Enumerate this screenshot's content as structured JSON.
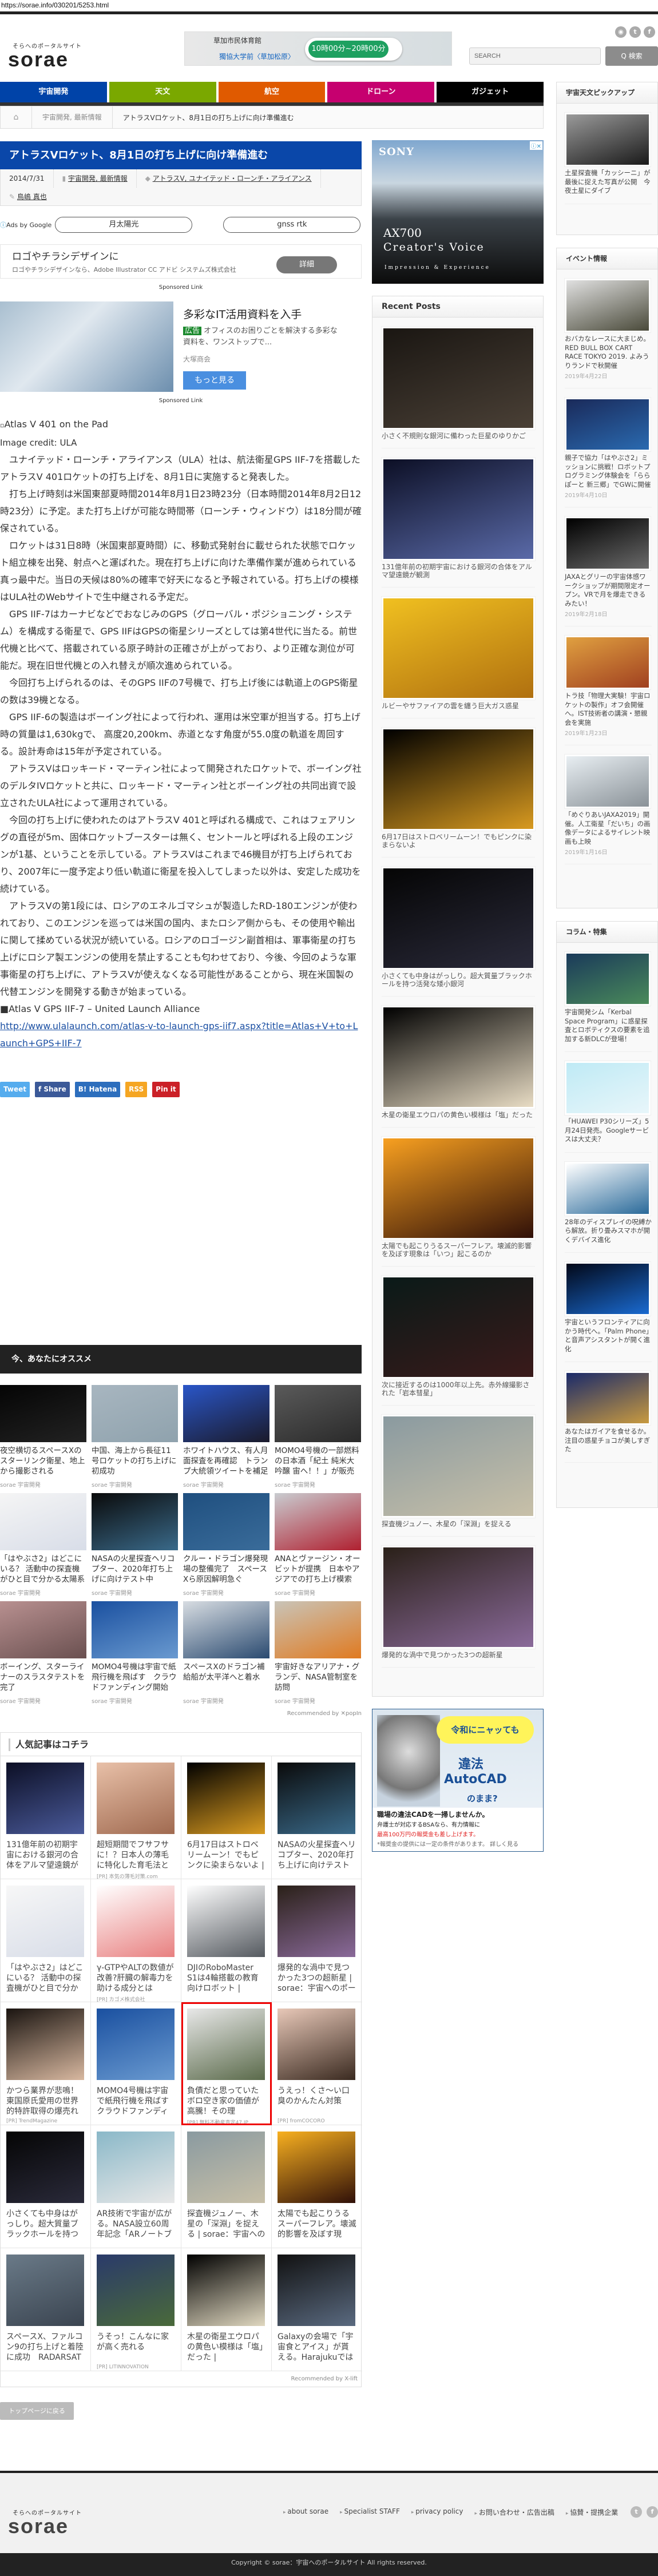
{
  "browser": {
    "url": "https://sorae.info/030201/5253.html"
  },
  "header": {
    "tagline": "そらへのポータルサイト",
    "logo": "sorae",
    "ad": {
      "place": "草加市民体育館",
      "place2": "獨協大学前〈草加松原〉",
      "hours": "10時00分~20時00分"
    },
    "social": [
      "rss-icon",
      "twitter-icon",
      "facebook-icon"
    ],
    "search_placeholder": "SEARCH",
    "search_button": "Q 検索"
  },
  "nav": [
    {
      "label": "宇宙開発",
      "color": "#0043a8"
    },
    {
      "label": "天文",
      "color": "#7aa800"
    },
    {
      "label": "航空",
      "color": "#e05a00"
    },
    {
      "label": "ドローン",
      "color": "#c6006f"
    },
    {
      "label": "ガジェット",
      "color": "#000000"
    }
  ],
  "breadcrumb": {
    "category": "宇宙開発, 最新情報",
    "current": "アトラスVロケット、8月1日の打ち上げに向け準備進む"
  },
  "article": {
    "title": "アトラスVロケット、8月1日の打ち上げに向け準備進む",
    "date": "2014/7/31",
    "categories": "宇宙開発, 最新情報",
    "tags": "アトラスV, ユナイテッド・ローンチ・アライアンス",
    "author": "鳥嶋 真也",
    "ads_by_google": "Ads by Google",
    "keywords": [
      "月太陽光",
      "gnss rtk"
    ],
    "ad1": {
      "headline": "ロゴやチラシデザインに",
      "desc": "ロゴやチラシデザインなら、Adobe Illustrator CC アドビ システムズ株式会社",
      "button": "詳細"
    },
    "sponsored": "Sponsored Link",
    "ad2": {
      "headline": "多彩なIT活用資料を入手",
      "badge": "広告",
      "desc": "オフィスのお困りごとを解決する多彩な資料を、ワンストップで...",
      "source": "大塚商会",
      "button": "もっと見る"
    },
    "image_alt": "Atlas V 401 on the Pad",
    "image_credit": "Image credit: ULA",
    "paragraphs": [
      "ユナイテッド・ローンチ・アライアンス（ULA）社は、航法衛星GPS IIF-7を搭載したアトラスV 401ロケットの打ち上げを、8月1日に実施すると発表した。",
      "打ち上げ時刻は米国東部夏時間2014年8月1日23時23分（日本時間2014年8月2日12時23分）に予定。また打ち上げが可能な時間帯（ローンチ・ウィンドウ）は18分間が確保されている。",
      "ロケットは31日8時（米国東部夏時間）に、移動式発射台に載せられた状態でロケット組立棟を出発、射点へと運ばれた。現在打ち上げに向けた準備作業が進められている真っ最中だ。当日の天候は80%の確率で好天になると予報されている。打ち上げの模様はULA社のWebサイトで生中継される予定だ。",
      "GPS IIF-7はカーナビなどでおなじみのGPS（グローバル・ポジショニング・システム）を構成する衛星で、GPS IIFはGPSの衛星シリーズとしては第4世代に当たる。前世代機と比べて、搭載されている原子時計の正確さが上がっており、より正確な測位が可能だ。現在旧世代機との入れ替えが順次進められている。",
      "今回打ち上げられるのは、そのGPS IIFの7号機で、打ち上げ後には軌道上のGPS衛星の数は39機となる。",
      "GPS IIF-6の製造はボーイング社によって行われ、運用は米空軍が担当する。打ち上げ時の質量は1,630kgで、 高度20,200km、赤道となす角度が55.0度の軌道を周回する。設計寿命は15年が予定されている。",
      "アトラスVはロッキード・マーティン社によって開発されたロケットで、ボーイング社のデルタIVロケットと共に、ロッキード・マーティン社とボーイング社の共同出資で設立されたULA社によって運用されている。",
      "今回の打ち上げに使われたのはアトラスV 401と呼ばれる構成で、これはフェアリングの直径が5m、固体ロケットブースターは無く、セントールと呼ばれる上段のエンジンが1基、ということを示している。アトラスVはこれまで46機目が打ち上げられており、2007年に一度予定より低い軌道に衛星を投入してしまった以外は、安定した成功を続けている。",
      "アトラスVの第1段には、ロシアのエネルゴマシュが製造したRD-180エンジンが使われており、このエンジンを巡っては米国の国内、またロシア側からも、その使用や輸出に関して揉めている状況が続いている。ロシアのロゴージン副首相は、軍事衛星の打ち上げにロシア製エンジンの使用を禁止することも匂わせており、今後、今回のような軍事衛星の打ち上げに、アトラスVが使えなくなる可能性があることから、現在米国製の代替エンジンを開発する動きが始まっている。"
    ],
    "reference": "■Atlas V GPS IIF-7 – United Launch Alliance",
    "reference_link": "http://www.ulalaunch.com/atlas-v-to-launch-gps-iif7.aspx?title=Atlas+V+to+Launch+GPS+IIF-7",
    "share": [
      {
        "label": "Tweet",
        "color": "#55acee",
        "icon": "twitter-icon"
      },
      {
        "label": "f Share",
        "color": "#3b5998",
        "icon": "facebook-icon"
      },
      {
        "label": "B! Hatena",
        "color": "#2c6ebd",
        "icon": "hatena-icon"
      },
      {
        "label": "RSS",
        "color": "#f5a623",
        "icon": "rss-icon"
      },
      {
        "label": "Pin it",
        "color": "#cb2027",
        "icon": "pinterest-icon"
      }
    ]
  },
  "recommend": {
    "title": "今、あなたにオススメ",
    "source": "sorae 宇宙開発",
    "credit": "Recommended by ✕popIn",
    "items": [
      {
        "title": "夜空横切るスペースXのスターリンク衛星、地上から撮影される",
        "c1": "#050505",
        "c2": "#222222"
      },
      {
        "title": "中国、海上から長征11号ロケットの打ち上げに初成功",
        "c1": "#a8b6c0",
        "c2": "#8fa2ad"
      },
      {
        "title": "ホワイトハウス、有人月面探査を再確認　トランプ大統領ツイートを補足",
        "c1": "#2a56c8",
        "c2": "#1a1a2a"
      },
      {
        "title": "MOMO4号機の一部燃料の日本酒「紀土 純米大吟醸 宙へ！！」が販売開始",
        "c1": "#5a5a5a",
        "c2": "#2a2a2a"
      },
      {
        "title": "「はやぶさ2」はどこにいる？ 活動中の探査機がひと目で分かる太陽系マ…",
        "c1": "#f5f5f5",
        "c2": "#d8dde8"
      },
      {
        "title": "NASAの火星探査ヘリコプター、2020年打ち上げに向けテスト中",
        "c1": "#0a0a0a",
        "c2": "#3a6a8a"
      },
      {
        "title": "クルー・ドラゴン爆発現場の整備完了　スペースXら原因解明急ぐ",
        "c1": "#1f4f7f",
        "c2": "#3a6c9a"
      },
      {
        "title": "ANAとヴァージン・オービットが提携　日本やアジアでの打ち上げ模索",
        "c1": "#c9ccd0",
        "c2": "#b02030"
      },
      {
        "title": "ボーイング、スターライナーのスラスタテストを完了",
        "c1": "#b89090",
        "c2": "#6a5050"
      },
      {
        "title": "MOMO4号機は宇宙で紙飛行機を飛ばす　クラウドファンディング開始",
        "c1": "#1a50a0",
        "c2": "#6a9ad0"
      },
      {
        "title": "スペースXのドラゴン補給船が太平洋へと着水",
        "c1": "#d8dde2",
        "c2": "#2a4a70"
      },
      {
        "title": "宇宙好きなアリアナ・グランデ、NASA管制室を訪問",
        "c1": "#c9c4b8",
        "c2": "#e07a20"
      }
    ]
  },
  "popular": {
    "title": "人気記事はコチラ",
    "credit": "Recommended by X-lift",
    "items": [
      {
        "title": "131億年前の初期宇宙における銀河の合体をアルマ望遠鏡が観",
        "pr": "",
        "c1": "#0c0f25",
        "c2": "#4a5a9a"
      },
      {
        "title": "超短期間でフサフサに！？日本人の薄毛に特化した育毛法と",
        "pr": "[PR] 本気の薄毛対策.com",
        "c1": "#e8c0a8",
        "c2": "#a06a50"
      },
      {
        "title": "6月17日はストロベリームーン！でもピンクに染まらないよ |",
        "pr": "",
        "c1": "#000000",
        "c2": "#d89a20"
      },
      {
        "title": "NASAの火星探査ヘリコプター、2020年打ち上げに向けテスト",
        "pr": "",
        "c1": "#0a0a0a",
        "c2": "#3a6a8a"
      },
      {
        "title": "「はやぶさ2」はどこにいる？ 活動中の探査機がひと目で分か",
        "pr": "",
        "c1": "#f7f7f7",
        "c2": "#d8dde8"
      },
      {
        "title": "γ-GTPやALTの数値が改善?肝臓の解毒力を助ける成分とは",
        "pr": "[PR] カゴメ株式会社",
        "c1": "#ffffff",
        "c2": "#e88080"
      },
      {
        "title": "DJIのRoboMaster S1は4輪搭載の教育向けロボット | sorae：宇",
        "pr": "",
        "c1": "#ffffff",
        "c2": "#555a60"
      },
      {
        "title": "爆発的な渦中で見つかった3つの超新星 | sorae：宇宙へのポー",
        "pr": "",
        "c1": "#2a2018",
        "c2": "#8a6a9a"
      },
      {
        "title": "かつら業界が悲鳴！東国原氏愛用の世界的特許取得の爆売れ",
        "pr": "[PR] TrendMagazine",
        "c1": "#1a1410",
        "c2": "#d8b8a0"
      },
      {
        "title": "MOMO4号機は宇宙で紙飛行機を飛ばす　クラウドファンディ",
        "pr": "",
        "c1": "#1a50a0",
        "c2": "#6a9ad0"
      },
      {
        "title": "負債だと思っていたボロ空き家の価値が高騰！その理",
        "pr": "[PR] 無料不動産査定47.JP",
        "c1": "#e8e8e8",
        "c2": "#5a6a4a",
        "highlight": true
      },
      {
        "title": "うえっ！くさ〜い口臭のかんたん対策",
        "pr": "[PR] fromCOCORO",
        "c1": "#e8c8b8",
        "c2": "#3a2a20"
      },
      {
        "title": "小さくても中身はがっしり。超大質量ブラックホールを持つ",
        "pr": "",
        "c1": "#050505",
        "c2": "#2a2a3a"
      },
      {
        "title": "AR技術で宇宙が広がる。NASA設立60周年記念「ARノートブ",
        "pr": "",
        "c1": "#8ab8c8",
        "c2": "#e8e8e8"
      },
      {
        "title": "探査機ジュノー、木星の「深淵」を捉える | sorae：宇宙への",
        "pr": "",
        "c1": "#8a9aa0",
        "c2": "#c8c0a8"
      },
      {
        "title": "太陽でも起こりうるスーパーフレア。壊滅的影響を及ぼす現",
        "pr": "",
        "c1": "#f8b020",
        "c2": "#301008"
      },
      {
        "title": "スペースX、ファルコン9の打ち上げと着陸に成功　RADARSAT",
        "pr": "",
        "c1": "#6a7a88",
        "c2": "#3a4450"
      },
      {
        "title": "うそっ！こんなに家が高く売れる",
        "pr": "[PR] LITINNOVATION",
        "c1": "#2a3a6a",
        "c2": "#4a6a3a"
      },
      {
        "title": "木星の衛星エウロパの黄色い模様は「塩」だった |",
        "pr": "",
        "c1": "#000000",
        "c2": "#e0d8c0"
      },
      {
        "title": "Galaxyの会場で「宇宙食とアイス」が貰える。Harajukuでは",
        "pr": "",
        "c1": "#111111",
        "c2": "#5a6a80"
      }
    ],
    "back_to_top": "トップページに戻る"
  },
  "middle": {
    "sony_ad": {
      "brand": "SONY",
      "model": "AX700",
      "line": "Creator's Voice",
      "sub": "Impression & Experience"
    },
    "recent_title": "Recent Posts",
    "recent": [
      {
        "title": "小さく不規則な銀河に備わった巨星のゆりかご",
        "c1": "#1a1612",
        "c2": "#4a4036"
      },
      {
        "title": "131億年前の初期宇宙における銀河の合体をアルマ望遠鏡が観測",
        "c1": "#0c0f25",
        "c2": "#5a6aa8"
      },
      {
        "title": "ルビーやサファイアの雲を纏う巨大ガス惑星",
        "c1": "#f0c020",
        "c2": "#b07010"
      },
      {
        "title": "6月17日はストロベリームーン！でもピンクに染まらないよ",
        "c1": "#000000",
        "c2": "#d89a20"
      },
      {
        "title": "小さくても中身はがっしり。超大質量ブラックホールを持つ活発な矮小銀河",
        "c1": "#050505",
        "c2": "#2a2a3a"
      },
      {
        "title": "木星の衛星エウロパの黄色い模様は「塩」だった",
        "c1": "#000000",
        "c2": "#e8dcc4"
      },
      {
        "title": "太陽でも起こりうるスーパーフレア。壊滅的影響を及ぼす現象は「いつ」起こるのか",
        "c1": "#f8a020",
        "c2": "#301008"
      },
      {
        "title": "次に接近するのは1000年以上先。赤外線撮影された「岩本彗星」",
        "c1": "#0a1a18",
        "c2": "#3a1a1a"
      },
      {
        "title": "探査機ジュノー、木星の「深淵」を捉える",
        "c1": "#8a9aa0",
        "c2": "#c8c0a8"
      },
      {
        "title": "爆発的な渦中で見つかった3つの超新星",
        "c1": "#2a2018",
        "c2": "#8a6a9a"
      }
    ],
    "cad_ad": {
      "bubble": "令和にニャッても",
      "l1": "違法",
      "l2": "AutoCAD",
      "l3": "のまま?",
      "b1": "職場の違法CADを一掃しませんか。",
      "b2": "弁護士が対応するBSAなら、有力情報に",
      "b3": "最高100万円の報奨金も差し上げます。",
      "b4": "*報奨金の提供には一定の条件があります。 詳しく見る"
    }
  },
  "sidebar": {
    "pickup": {
      "title": "宇宙天文ピックアップ",
      "items": [
        {
          "title": "土星探査機「カッシーニ」が最後に捉えた写真が公開　今夜土星にダイブ",
          "date": "",
          "c1": "#9a9a9a",
          "c2": "#1a1a1a"
        }
      ]
    },
    "event": {
      "title": "イベント情報",
      "items": [
        {
          "title": "おバカなレースに大まじめ。RED BULL BOX CART RACE TOKYO 2019. よみうりランドで秋開催",
          "date": "2019年4月22日",
          "c1": "#e0e0e0",
          "c2": "#4a4a3a"
        },
        {
          "title": "親子で協力「はやぶさ2」ミッションに挑戦！ロボットプログラミング体験会を「ららぽーと 新三郷」でGWに開催",
          "date": "2019年4月10日",
          "c1": "#1a2a5a",
          "c2": "#2a6ab0"
        },
        {
          "title": "JAXAとグリーの宇宙体感ワークショップが期間限定オープン。VRで月を爆走できるみたい！",
          "date": "2019年2月18日",
          "c1": "#000000",
          "c2": "#6a6a6a"
        },
        {
          "title": "トラ技「物理大実験！宇宙ロケットの製作」オフ会開催へ。IST技術者の講演・懇親会を実施",
          "date": "2019年1月23日",
          "c1": "#e0a040",
          "c2": "#a04020"
        },
        {
          "title": "「めぐりあいJAXA2019」開催。人工衛星「だいち」の画像データによるサイレント映画も上映",
          "date": "2019年1月16日",
          "c1": "#e8eef2",
          "c2": "#8a9298"
        }
      ]
    },
    "column": {
      "title": "コラム・特集",
      "items": [
        {
          "title": "宇宙開発シム「Kerbal Space Program」に惑星探査とロボティクスの要素を追加する新DLCが登場！",
          "date": "",
          "c1": "#1a3a5a",
          "c2": "#4a8a5a"
        },
        {
          "title": "「HUAWEI P30シリーズ」5月24日発売。Googleサービスは大丈夫？",
          "date": "",
          "c1": "#bfeaf5",
          "c2": "#e8f6fa"
        },
        {
          "title": "28年のディスプレイの呪縛から解放。折り畳みスマホが開くデバイス進化",
          "date": "",
          "c1": "#ffffff",
          "c2": "#2a6a9a"
        },
        {
          "title": "宇宙というフロンティアに向かう時代へ。「Palm Phone」と音声アシスタントが開く進化",
          "date": "",
          "c1": "#020818",
          "c2": "#1a6ad0"
        },
        {
          "title": "あなたはガイアを食せるか。注目の惑星チョコが美しすぎた",
          "date": "",
          "c1": "#1a2a6a",
          "c2": "#c89a40"
        }
      ]
    }
  },
  "footer": {
    "tagline": "そらへのポータルサイト",
    "logo": "sorae",
    "links": [
      "about sorae",
      "Specialist STAFF",
      "privacy policy",
      "お問い合わせ・広告出稿",
      "協賛・提携企業"
    ],
    "copyright": "Copyright ©  sorae：宇宙へのポータルサイト All rights reserved."
  }
}
